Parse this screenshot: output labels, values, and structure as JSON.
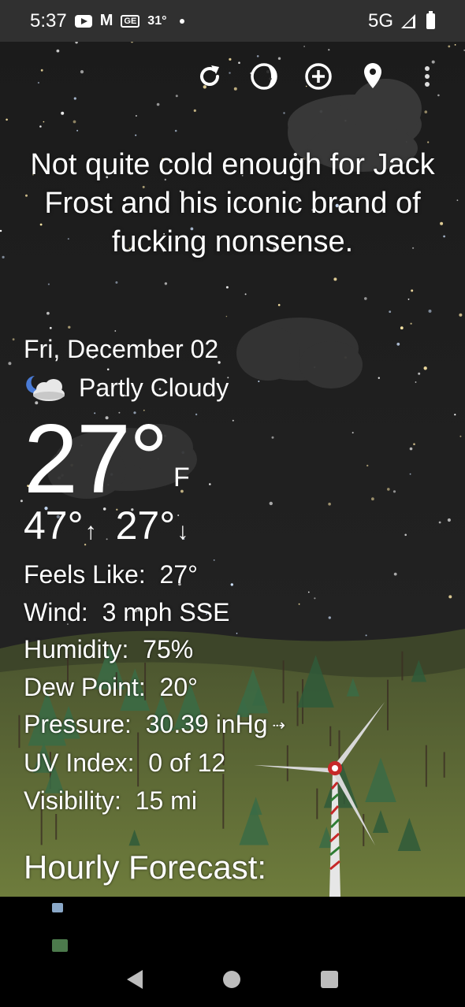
{
  "status_bar": {
    "time": "5:37",
    "weather_temp": "31°",
    "network": "5G",
    "icons": [
      "youtube-icon",
      "gmail-icon",
      "news-icon",
      "notification-dot",
      "signal-icon",
      "battery-icon"
    ]
  },
  "toolbar": {
    "icons": [
      "refresh-icon",
      "moon-phase-icon",
      "add-location-icon",
      "location-pin-icon",
      "more-vert-icon"
    ]
  },
  "headline": "Not quite cold enough for Jack Frost and his iconic brand of fucking nonsense.",
  "weather": {
    "date": "Fri, December 02",
    "condition": "Partly Cloudy",
    "temperature": "27°",
    "unit": "F",
    "high": "47°",
    "high_arrow": "↑",
    "low": "27°",
    "low_arrow": "↓",
    "details": [
      {
        "label": "Feels Like:",
        "value": "27°"
      },
      {
        "label": "Wind:",
        "value": "3 mph SSE"
      },
      {
        "label": "Humidity:",
        "value": "75%"
      },
      {
        "label": "Dew Point:",
        "value": "20°"
      },
      {
        "label": "Pressure:",
        "value": "30.39 inHg"
      },
      {
        "label": "UV Index:",
        "value": "0 of 12"
      },
      {
        "label": "Visibility:",
        "value": "15 mi"
      }
    ],
    "pressure_trend": "⇢"
  },
  "hourly_title": "Hourly Forecast:",
  "colors": {
    "status_bar_bg": "#303030",
    "sky": "#1c1c1c",
    "ground": "#5d6a3a",
    "text": "#ffffff"
  }
}
